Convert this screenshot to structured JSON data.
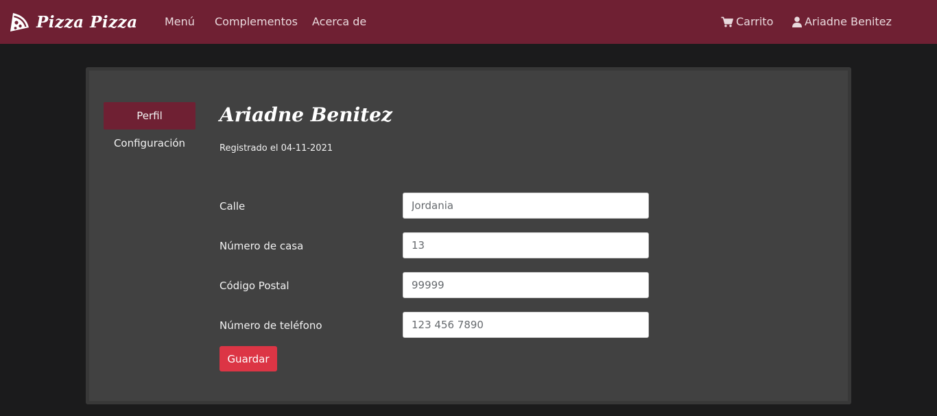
{
  "navbar": {
    "brand": "Pizza Pizza",
    "links": [
      "Menú",
      "Complementos",
      "Acerca de"
    ],
    "cart_label": "Carrito",
    "user_label": "Ariadne Benitez",
    "background_color": "#6f2033"
  },
  "sidebar": {
    "items": [
      {
        "label": "Perfil",
        "active": true
      },
      {
        "label": "Configuración",
        "active": false
      }
    ]
  },
  "profile": {
    "name": "Ariadne Benitez",
    "registered": "Registrado el 04-11-2021"
  },
  "form": {
    "fields": [
      {
        "label": "Calle",
        "value": "Jordania"
      },
      {
        "label": "Número de casa",
        "value": "13"
      },
      {
        "label": "Código Postal",
        "value": "99999"
      },
      {
        "label": "Número de teléfono",
        "value": "123 456 7890"
      }
    ],
    "save_label": "Guardar",
    "save_color": "#dc3545"
  },
  "icons": {
    "logo": "pizza-slice-icon",
    "cart": "shopping-cart-icon",
    "user": "user-icon"
  }
}
